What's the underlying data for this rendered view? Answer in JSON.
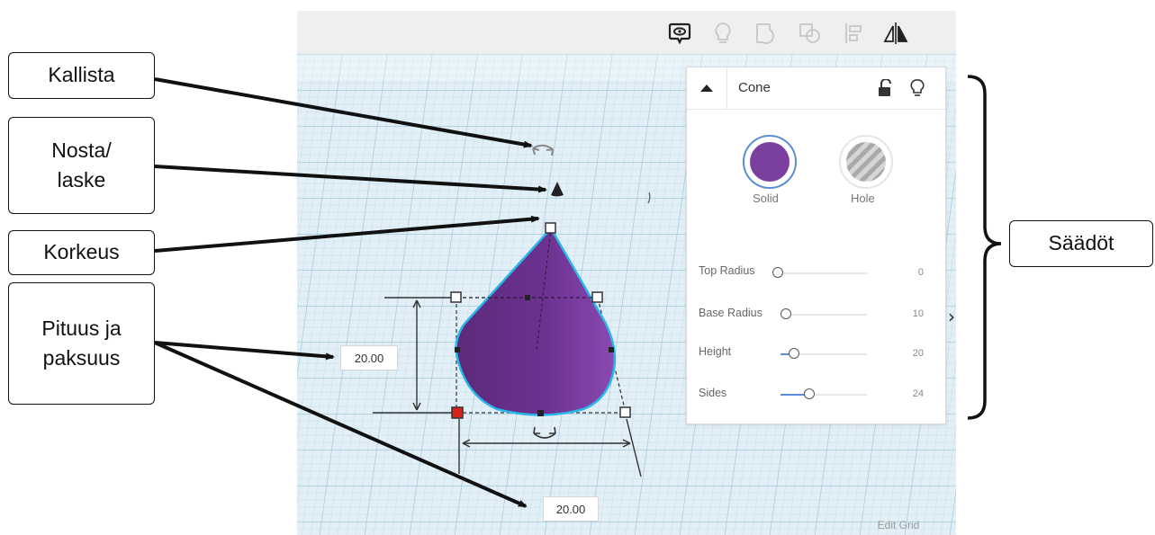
{
  "toolbar": {
    "icons": [
      "comment-icon",
      "lightbulb-icon",
      "group-icon",
      "ungroup-icon",
      "align-icon",
      "mirror-icon"
    ]
  },
  "panel": {
    "shape_name": "Cone",
    "solid": {
      "label": "Solid",
      "color": "#7b3fa0"
    },
    "hole": {
      "label": "Hole"
    },
    "properties": [
      {
        "label": "Top Radius",
        "value": "0",
        "fraction": 0.0
      },
      {
        "label": "Base Radius",
        "value": "10",
        "fraction": 0.0
      },
      {
        "label": "Height",
        "value": "20",
        "fraction": 0.1
      },
      {
        "label": "Sides",
        "value": "24",
        "fraction": 0.3
      }
    ]
  },
  "dimensions": {
    "width": "20.00",
    "length": "20.00"
  },
  "viewport": {
    "edit_grid": "Edit Grid",
    "expand_chevron": "›"
  },
  "colors": {
    "accent": "#5a8ed6",
    "shape": "#7b3fa0",
    "selection_outline": "#29b6e8",
    "grid": "#a9cde2"
  },
  "annotations": {
    "kallista": "Kallista",
    "nosta_laske": "Nosta/\nlaske",
    "korkeus": "Korkeus",
    "pituus_paksuus": "Pituus ja\npaksuus",
    "saadot": "Säädöt"
  }
}
